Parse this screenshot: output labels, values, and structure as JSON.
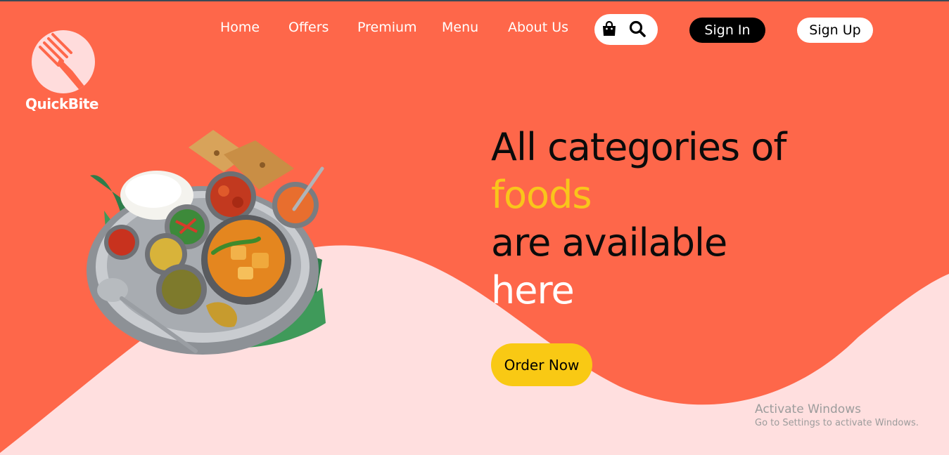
{
  "brand": {
    "name": "QuickBite",
    "logo_icon": "fork-icon"
  },
  "nav": {
    "items": [
      {
        "label": "Home"
      },
      {
        "label": "Offers"
      },
      {
        "label": "Premium"
      },
      {
        "label": "Menu"
      },
      {
        "label": "About Us"
      }
    ],
    "icons": [
      "shopping-bag-icon",
      "search-icon"
    ],
    "sign_in": "Sign In",
    "sign_up": "Sign Up"
  },
  "hero": {
    "line1": "All categories of",
    "line2": "foods",
    "line3": "are available",
    "line4": "here",
    "cta": "Order Now",
    "image": "indian-thali-food-platter"
  },
  "watermark": {
    "title": "Activate Windows",
    "subtitle": "Go to Settings to activate Windows."
  },
  "colors": {
    "background": "#fe674a",
    "wave": "#ffdfdf",
    "accent_yellow": "#f9c51b",
    "sign_in_bg": "#000000",
    "sign_up_bg": "#ffffff"
  }
}
